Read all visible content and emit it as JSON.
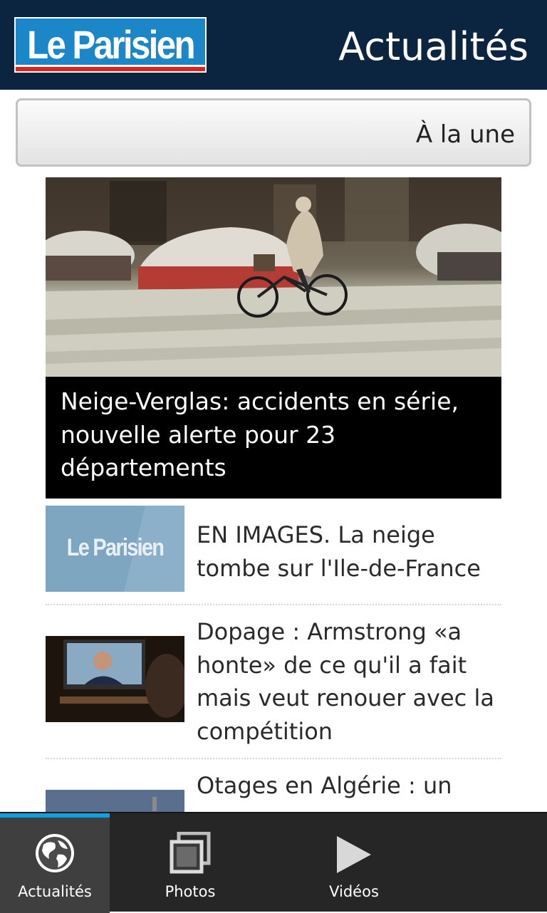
{
  "header": {
    "logo_text": "Le Parisien",
    "title": "Actualités"
  },
  "section_selector": {
    "selected": "À la une"
  },
  "hero": {
    "title": "Neige-Verglas: accidents en série, nouvelle alerte pour 23 départements"
  },
  "articles": [
    {
      "title": "EN IMAGES. La neige tombe sur l'Ile-de-France",
      "thumb_logo_text": "Le Parisien"
    },
    {
      "title": "Dopage : Armstrong «a honte» de ce qu'il a fait mais veut renouer avec la compétition"
    },
    {
      "title": "Otages en Algérie : un"
    }
  ],
  "tabs": [
    {
      "label": "Actualités",
      "icon": "globe-icon",
      "active": true
    },
    {
      "label": "Photos",
      "icon": "photos-icon",
      "active": false
    },
    {
      "label": "Vidéos",
      "icon": "play-icon",
      "active": false
    }
  ],
  "colors": {
    "header_bg": "#0b2440",
    "logo_blue": "#1b86c8",
    "logo_red": "#e2231a",
    "tab_accent": "#0fa0e0",
    "tabbar_bg": "#262626"
  }
}
